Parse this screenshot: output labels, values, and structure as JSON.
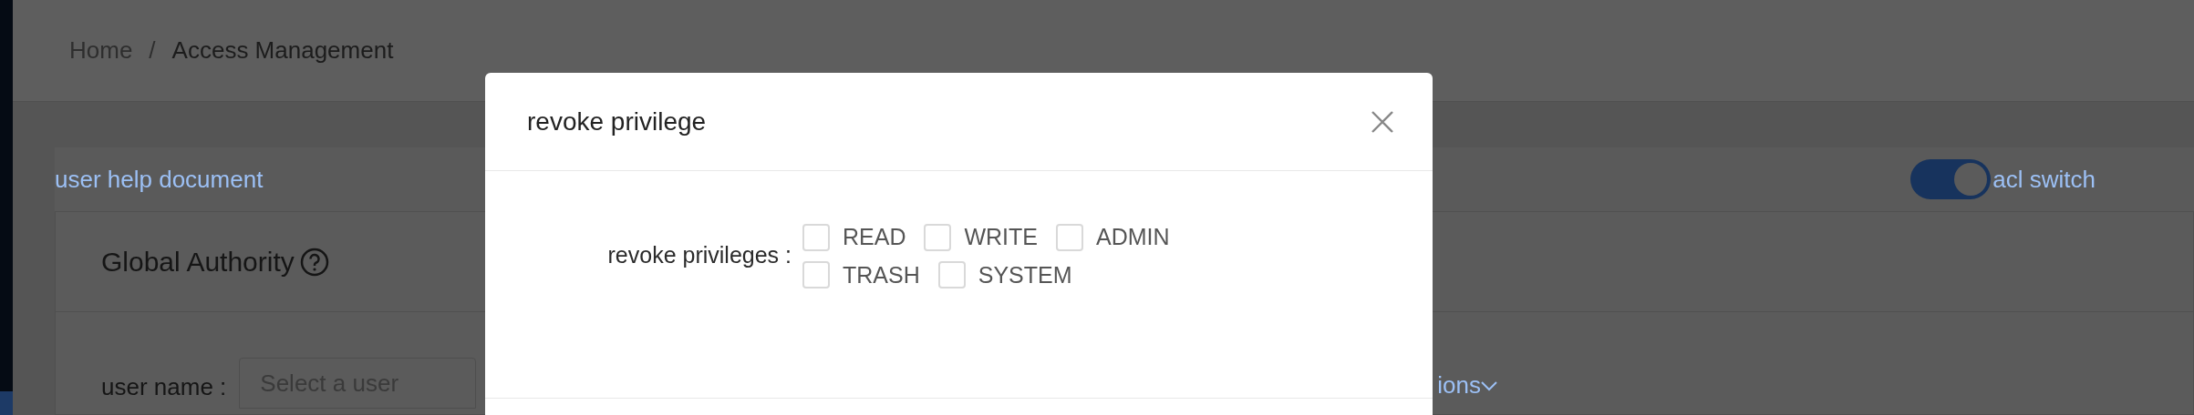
{
  "breadcrumb": [
    "Home",
    "/",
    "Access Management"
  ],
  "help_link": "user help document",
  "acl_switch": {
    "label": "acl switch",
    "on": true
  },
  "card": {
    "title": "Global Authority",
    "user_name": {
      "label": "user name :",
      "placeholder": "Select a user"
    },
    "more_link": "ions"
  },
  "dialog": {
    "title": "revoke privilege",
    "field_label": "revoke privileges :",
    "options": [
      {
        "label": "READ",
        "checked": false
      },
      {
        "label": "WRITE",
        "checked": false
      },
      {
        "label": "ADMIN",
        "checked": false
      },
      {
        "label": "TRASH",
        "checked": false
      },
      {
        "label": "SYSTEM",
        "checked": false
      }
    ]
  }
}
